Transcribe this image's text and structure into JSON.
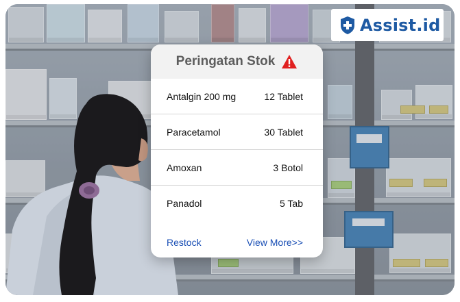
{
  "brand": {
    "name": "Assist.id",
    "color": "#1e5aa3"
  },
  "alert_card": {
    "title": "Peringatan Stok",
    "icon": "warning-icon",
    "icon_color": "#e02020",
    "items": [
      {
        "name": "Antalgin 200 mg",
        "stock": "12 Tablet"
      },
      {
        "name": "Paracetamol",
        "stock": "30 Tablet"
      },
      {
        "name": "Amoxan",
        "stock": "3 Botol"
      },
      {
        "name": "Panadol",
        "stock": "5 Tab"
      }
    ],
    "restock_label": "Restock",
    "view_more_label": "View More>>",
    "link_color": "#1a4fb5"
  }
}
